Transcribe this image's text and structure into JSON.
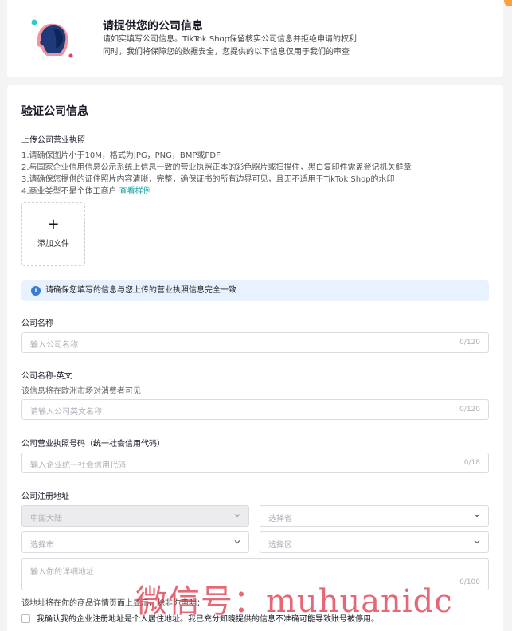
{
  "header": {
    "title": "请提供您的公司信息",
    "desc_line1": "请如实填写公司信息。TikTok Shop保留核实公司信息并拒绝申请的权利",
    "desc_line2": "同时，我们将保障您的数据安全，您提供的以下信息仅用于我们的审查"
  },
  "verify": {
    "title": "验证公司信息",
    "upload_label": "上传公司营业执照",
    "rules": [
      "1.请确保图片小于10M，格式为JPG，PNG，BMP或PDF",
      "2.与国家企业信用信息公示系统上信息一致的营业执照正本的彩色照片或扫描件，黑白复印件需盖登记机关鲜章",
      "3.请确保您提供的证件照片内容清晰，完整，确保证书的所有边界可见，且无不适用于TikTok Shop的水印",
      "4.商业类型不是个体工商户"
    ],
    "view_example_link": "查看样例",
    "upload_plus": "+",
    "upload_button": "添加文件",
    "notice": "请确保您填写的信息与您上传的营业执照信息完全一致",
    "info_glyph": "i"
  },
  "fields": {
    "company_name": {
      "label": "公司名称",
      "placeholder": "输入公司名称",
      "count": "0/120"
    },
    "company_name_en": {
      "label": "公司名称-英文",
      "hint": "该信息将在欧洲市场对消费者可见",
      "placeholder": "请输入公司英文名称",
      "count": "0/120"
    },
    "license_number": {
      "label": "公司营业执照号码（统一社会信用代码）",
      "placeholder": "输入企业统一社会信用代码",
      "count": "0/18"
    },
    "address": {
      "label": "公司注册地址",
      "country": "中国大陆",
      "province_placeholder": "选择省",
      "city_placeholder": "选择市",
      "district_placeholder": "选择区",
      "detail_placeholder": "输入你的详细地址",
      "detail_count": "0/100",
      "note": "该地址将在你的商品详情页面上显示，除非你声明：",
      "confirm": "我确认我的企业注册地址是个人居住地址。我已充分知晓提供的信息不准确可能导致账号被停用。"
    }
  },
  "watermark": "微信号：muhuanidc",
  "colors": {
    "accent": "#13a3a3",
    "notice_bg": "#e8f1fe",
    "info": "#3a7bd5",
    "watermark": "#dc283c"
  }
}
